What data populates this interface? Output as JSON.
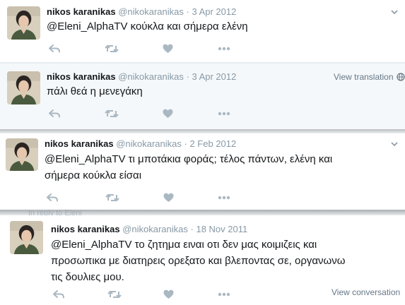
{
  "tweets": [
    {
      "name": "nikos karanikas",
      "handle": "@nikokaranikas",
      "separator": "·",
      "date": "3 Apr 2012",
      "lines": [
        "@Eleni_AlphaTV κούκλα και σήμερα ελένη"
      ],
      "menu_icon": "chevron-down-icon"
    },
    {
      "name": "nikos karanikas",
      "handle": "@nikokaranikas",
      "separator": "·",
      "date": "3 Apr 2012",
      "lines": [
        "πάλι θεά η μενεγάκη"
      ],
      "view_translation": "View translation",
      "translate_icon": "globe-icon"
    },
    {
      "name": "nikos karanikas",
      "handle": "@nikokaranikas",
      "separator": "·",
      "date": "2 Feb 2012",
      "lines": [
        "@Eleni_AlphaTV τι μποτάκια φοράς; τέλος πάντων, ελένη και",
        "σήμερα κούκλα είσαι"
      ],
      "menu_icon": "chevron-down-icon"
    },
    {
      "name": "nikos karanikas",
      "handle": "@nikokaranikas",
      "separator": "·",
      "date": "18 Nov 2011",
      "lines": [
        "@Eleni_AlphaTV το ζητημα ειναι οτι δεν μας κοιμιζεις και",
        "προσωπικα με διατηρεις ορεξατο και βλεποντας σε, οργανωνω",
        "τις δουλιες μου."
      ],
      "view_conversation": "View conversation"
    }
  ],
  "partial_reply_text": "In reply to Eleni",
  "action_icons": [
    "reply-icon",
    "retweet-icon",
    "like-icon",
    "more-icon"
  ],
  "colors": {
    "name": "#14171a",
    "meta": "#8899a6",
    "icon": "#aab8c2",
    "link": "#657786"
  }
}
